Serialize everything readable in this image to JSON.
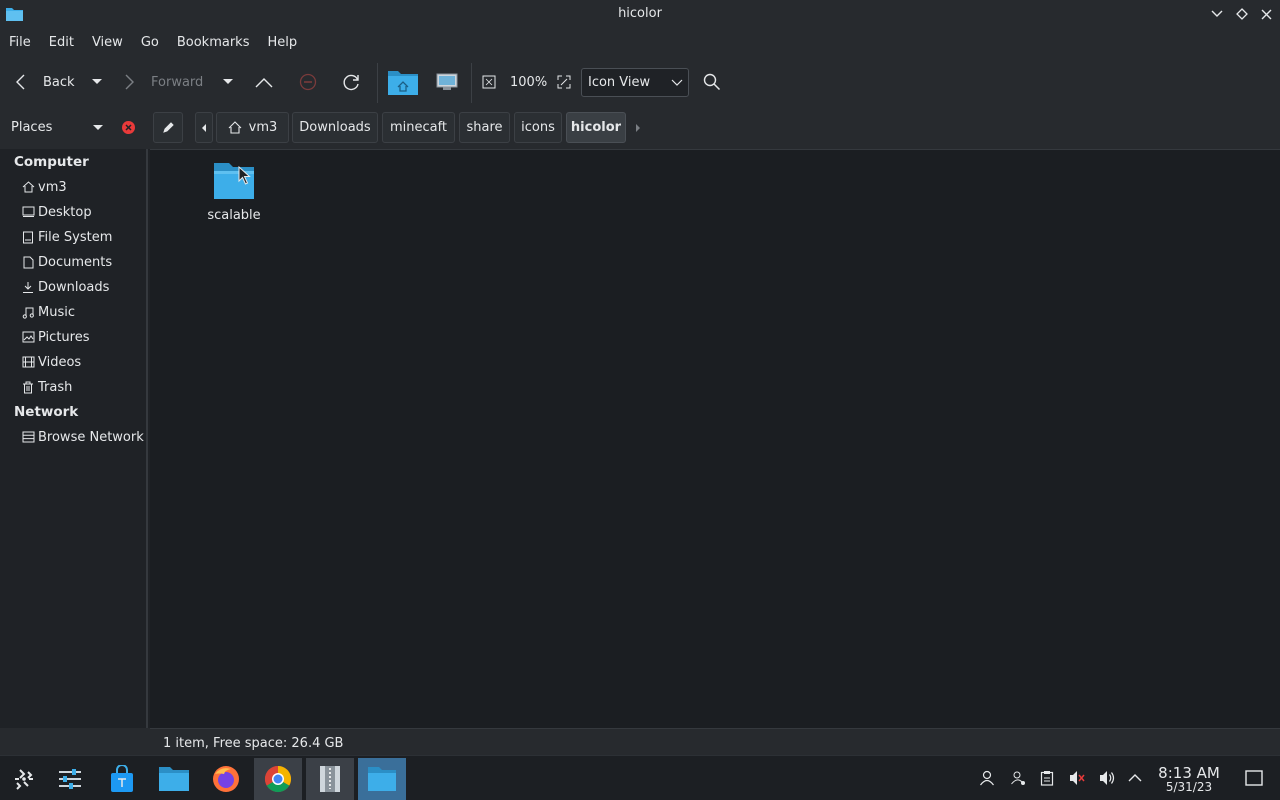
{
  "window": {
    "title": "hicolor",
    "icon": "folder-icon",
    "controls": [
      "minimize-icon",
      "maximize-icon",
      "close-icon"
    ]
  },
  "menu": [
    "File",
    "Edit",
    "View",
    "Go",
    "Bookmarks",
    "Help"
  ],
  "toolbar": {
    "back_label": "Back",
    "forward_label": "Forward",
    "zoom_label": "100%",
    "view_mode": "Icon View"
  },
  "places": {
    "label": "Places"
  },
  "breadcrumb": [
    "vm3",
    "Downloads",
    "minecaft",
    "share",
    "icons",
    "hicolor"
  ],
  "sidebar": {
    "computer_heading": "Computer",
    "computer_items": [
      {
        "label": "vm3",
        "icon": "home-icon"
      },
      {
        "label": "Desktop",
        "icon": "desktop-icon"
      },
      {
        "label": "File System",
        "icon": "drive-icon"
      },
      {
        "label": "Documents",
        "icon": "document-icon"
      },
      {
        "label": "Downloads",
        "icon": "download-icon"
      },
      {
        "label": "Music",
        "icon": "music-icon"
      },
      {
        "label": "Pictures",
        "icon": "picture-icon"
      },
      {
        "label": "Videos",
        "icon": "video-icon"
      },
      {
        "label": "Trash",
        "icon": "trash-icon"
      }
    ],
    "network_heading": "Network",
    "network_items": [
      {
        "label": "Browse Network",
        "icon": "network-icon"
      }
    ]
  },
  "files": [
    {
      "name": "scalable",
      "icon": "folder-icon"
    }
  ],
  "status": "1 item, Free space: 26.4 GB",
  "taskbar": {
    "apps": [
      "application-launcher-icon",
      "settings-icon",
      "discover-store-icon",
      "file-manager-icon",
      "firefox-icon",
      "chrome-icon",
      "archive-icon",
      "file-manager-active-icon"
    ],
    "time": "8:13 AM",
    "date": "5/31/23"
  },
  "colors": {
    "accent": "#3daee9",
    "folder": "#3daee9",
    "close_red": "#e93a3a"
  }
}
